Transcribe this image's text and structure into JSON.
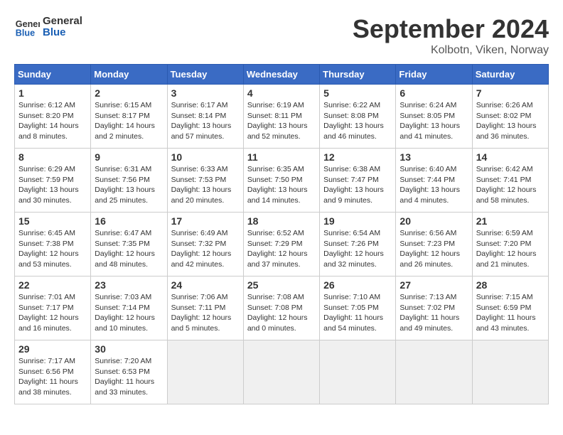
{
  "header": {
    "logo_line1": "General",
    "logo_line2": "Blue",
    "month": "September 2024",
    "location": "Kolbotn, Viken, Norway"
  },
  "weekdays": [
    "Sunday",
    "Monday",
    "Tuesday",
    "Wednesday",
    "Thursday",
    "Friday",
    "Saturday"
  ],
  "weeks": [
    [
      {
        "day": "1",
        "sunrise": "Sunrise: 6:12 AM",
        "sunset": "Sunset: 8:20 PM",
        "daylight": "Daylight: 14 hours and 8 minutes."
      },
      {
        "day": "2",
        "sunrise": "Sunrise: 6:15 AM",
        "sunset": "Sunset: 8:17 PM",
        "daylight": "Daylight: 14 hours and 2 minutes."
      },
      {
        "day": "3",
        "sunrise": "Sunrise: 6:17 AM",
        "sunset": "Sunset: 8:14 PM",
        "daylight": "Daylight: 13 hours and 57 minutes."
      },
      {
        "day": "4",
        "sunrise": "Sunrise: 6:19 AM",
        "sunset": "Sunset: 8:11 PM",
        "daylight": "Daylight: 13 hours and 52 minutes."
      },
      {
        "day": "5",
        "sunrise": "Sunrise: 6:22 AM",
        "sunset": "Sunset: 8:08 PM",
        "daylight": "Daylight: 13 hours and 46 minutes."
      },
      {
        "day": "6",
        "sunrise": "Sunrise: 6:24 AM",
        "sunset": "Sunset: 8:05 PM",
        "daylight": "Daylight: 13 hours and 41 minutes."
      },
      {
        "day": "7",
        "sunrise": "Sunrise: 6:26 AM",
        "sunset": "Sunset: 8:02 PM",
        "daylight": "Daylight: 13 hours and 36 minutes."
      }
    ],
    [
      {
        "day": "8",
        "sunrise": "Sunrise: 6:29 AM",
        "sunset": "Sunset: 7:59 PM",
        "daylight": "Daylight: 13 hours and 30 minutes."
      },
      {
        "day": "9",
        "sunrise": "Sunrise: 6:31 AM",
        "sunset": "Sunset: 7:56 PM",
        "daylight": "Daylight: 13 hours and 25 minutes."
      },
      {
        "day": "10",
        "sunrise": "Sunrise: 6:33 AM",
        "sunset": "Sunset: 7:53 PM",
        "daylight": "Daylight: 13 hours and 20 minutes."
      },
      {
        "day": "11",
        "sunrise": "Sunrise: 6:35 AM",
        "sunset": "Sunset: 7:50 PM",
        "daylight": "Daylight: 13 hours and 14 minutes."
      },
      {
        "day": "12",
        "sunrise": "Sunrise: 6:38 AM",
        "sunset": "Sunset: 7:47 PM",
        "daylight": "Daylight: 13 hours and 9 minutes."
      },
      {
        "day": "13",
        "sunrise": "Sunrise: 6:40 AM",
        "sunset": "Sunset: 7:44 PM",
        "daylight": "Daylight: 13 hours and 4 minutes."
      },
      {
        "day": "14",
        "sunrise": "Sunrise: 6:42 AM",
        "sunset": "Sunset: 7:41 PM",
        "daylight": "Daylight: 12 hours and 58 minutes."
      }
    ],
    [
      {
        "day": "15",
        "sunrise": "Sunrise: 6:45 AM",
        "sunset": "Sunset: 7:38 PM",
        "daylight": "Daylight: 12 hours and 53 minutes."
      },
      {
        "day": "16",
        "sunrise": "Sunrise: 6:47 AM",
        "sunset": "Sunset: 7:35 PM",
        "daylight": "Daylight: 12 hours and 48 minutes."
      },
      {
        "day": "17",
        "sunrise": "Sunrise: 6:49 AM",
        "sunset": "Sunset: 7:32 PM",
        "daylight": "Daylight: 12 hours and 42 minutes."
      },
      {
        "day": "18",
        "sunrise": "Sunrise: 6:52 AM",
        "sunset": "Sunset: 7:29 PM",
        "daylight": "Daylight: 12 hours and 37 minutes."
      },
      {
        "day": "19",
        "sunrise": "Sunrise: 6:54 AM",
        "sunset": "Sunset: 7:26 PM",
        "daylight": "Daylight: 12 hours and 32 minutes."
      },
      {
        "day": "20",
        "sunrise": "Sunrise: 6:56 AM",
        "sunset": "Sunset: 7:23 PM",
        "daylight": "Daylight: 12 hours and 26 minutes."
      },
      {
        "day": "21",
        "sunrise": "Sunrise: 6:59 AM",
        "sunset": "Sunset: 7:20 PM",
        "daylight": "Daylight: 12 hours and 21 minutes."
      }
    ],
    [
      {
        "day": "22",
        "sunrise": "Sunrise: 7:01 AM",
        "sunset": "Sunset: 7:17 PM",
        "daylight": "Daylight: 12 hours and 16 minutes."
      },
      {
        "day": "23",
        "sunrise": "Sunrise: 7:03 AM",
        "sunset": "Sunset: 7:14 PM",
        "daylight": "Daylight: 12 hours and 10 minutes."
      },
      {
        "day": "24",
        "sunrise": "Sunrise: 7:06 AM",
        "sunset": "Sunset: 7:11 PM",
        "daylight": "Daylight: 12 hours and 5 minutes."
      },
      {
        "day": "25",
        "sunrise": "Sunrise: 7:08 AM",
        "sunset": "Sunset: 7:08 PM",
        "daylight": "Daylight: 12 hours and 0 minutes."
      },
      {
        "day": "26",
        "sunrise": "Sunrise: 7:10 AM",
        "sunset": "Sunset: 7:05 PM",
        "daylight": "Daylight: 11 hours and 54 minutes."
      },
      {
        "day": "27",
        "sunrise": "Sunrise: 7:13 AM",
        "sunset": "Sunset: 7:02 PM",
        "daylight": "Daylight: 11 hours and 49 minutes."
      },
      {
        "day": "28",
        "sunrise": "Sunrise: 7:15 AM",
        "sunset": "Sunset: 6:59 PM",
        "daylight": "Daylight: 11 hours and 43 minutes."
      }
    ],
    [
      {
        "day": "29",
        "sunrise": "Sunrise: 7:17 AM",
        "sunset": "Sunset: 6:56 PM",
        "daylight": "Daylight: 11 hours and 38 minutes."
      },
      {
        "day": "30",
        "sunrise": "Sunrise: 7:20 AM",
        "sunset": "Sunset: 6:53 PM",
        "daylight": "Daylight: 11 hours and 33 minutes."
      },
      null,
      null,
      null,
      null,
      null
    ]
  ]
}
